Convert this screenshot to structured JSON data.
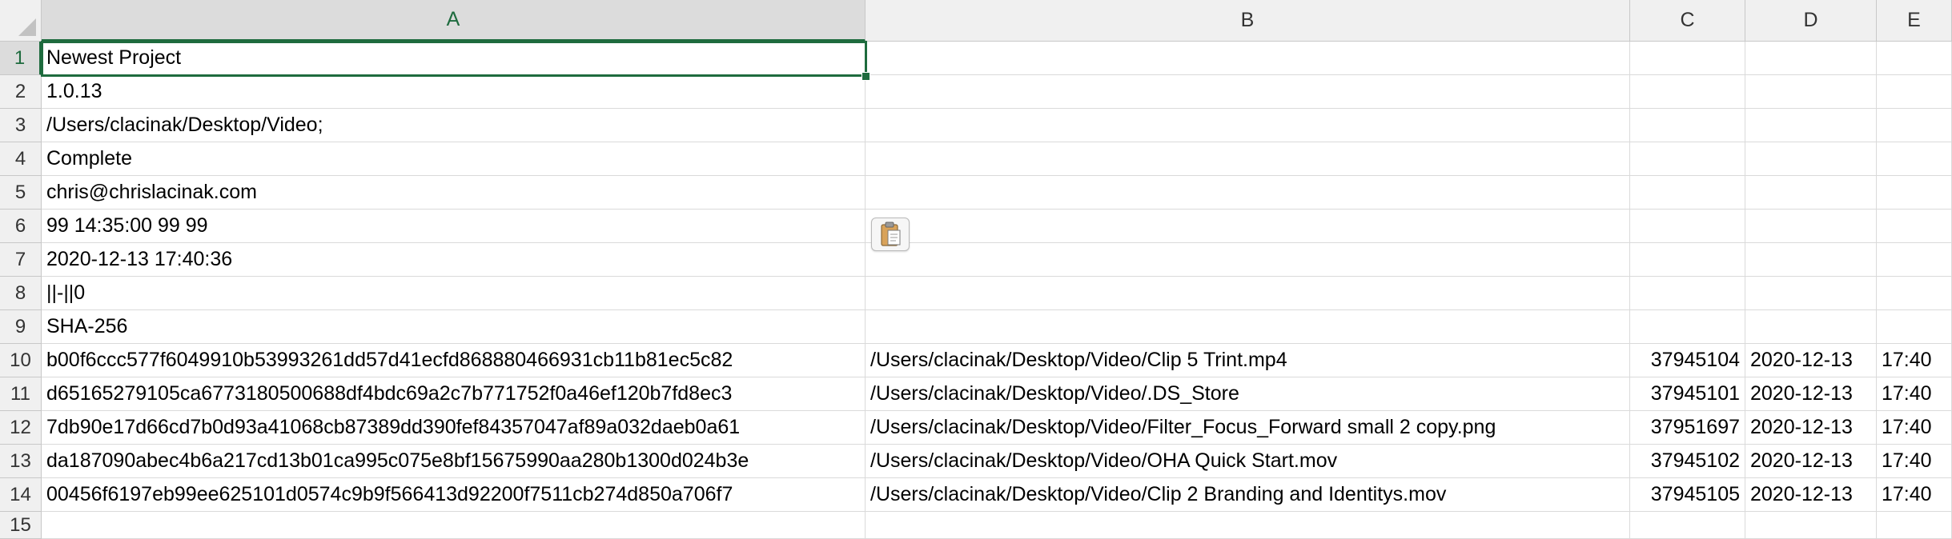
{
  "columns": [
    "A",
    "B",
    "C",
    "D",
    "E"
  ],
  "active_cell": "A1",
  "rows": [
    {
      "n": "1",
      "a": "Newest Project",
      "b": "",
      "c": "",
      "d": "",
      "e": ""
    },
    {
      "n": "2",
      "a": "1.0.13",
      "b": "",
      "c": "",
      "d": "",
      "e": ""
    },
    {
      "n": "3",
      "a": "/Users/clacinak/Desktop/Video;",
      "b": "",
      "c": "",
      "d": "",
      "e": ""
    },
    {
      "n": "4",
      "a": "Complete",
      "b": "",
      "c": "",
      "d": "",
      "e": ""
    },
    {
      "n": "5",
      "a": "chris@chrislacinak.com",
      "b": "",
      "c": "",
      "d": "",
      "e": ""
    },
    {
      "n": "6",
      "a": "99 14:35:00 99 99",
      "b": "",
      "c": "",
      "d": "",
      "e": ""
    },
    {
      "n": "7",
      "a": "2020-12-13 17:40:36",
      "b": "",
      "c": "",
      "d": "",
      "e": ""
    },
    {
      "n": "8",
      "a": "||-||0",
      "b": "",
      "c": "",
      "d": "",
      "e": ""
    },
    {
      "n": "9",
      "a": "SHA-256",
      "b": "",
      "c": "",
      "d": "",
      "e": ""
    },
    {
      "n": "10",
      "a": "b00f6ccc577f6049910b53993261dd57d41ecfd868880466931cb11b81ec5c82",
      "b": "/Users/clacinak/Desktop/Video/Clip 5 Trint.mp4",
      "c": "37945104",
      "d": "2020-12-13",
      "e": "17:40"
    },
    {
      "n": "11",
      "a": "d65165279105ca6773180500688df4bdc69a2c7b771752f0a46ef120b7fd8ec3",
      "b": "/Users/clacinak/Desktop/Video/.DS_Store",
      "c": "37945101",
      "d": "2020-12-13",
      "e": "17:40"
    },
    {
      "n": "12",
      "a": "7db90e17d66cd7b0d93a41068cb87389dd390fef84357047af89a032daeb0a61",
      "b": "/Users/clacinak/Desktop/Video/Filter_Focus_Forward small 2 copy.png",
      "c": "37951697",
      "d": "2020-12-13",
      "e": "17:40"
    },
    {
      "n": "13",
      "a": "da187090abec4b6a217cd13b01ca995c075e8bf15675990aa280b1300d024b3e",
      "b": "/Users/clacinak/Desktop/Video/OHA Quick Start.mov",
      "c": "37945102",
      "d": "2020-12-13",
      "e": "17:40"
    },
    {
      "n": "14",
      "a": "00456f6197eb99ee625101d0574c9b9f566413d92200f7511cb274d850a706f7",
      "b": "/Users/clacinak/Desktop/Video/Clip 2 Branding and Identitys.mov",
      "c": "37945105",
      "d": "2020-12-13",
      "e": "17:40"
    },
    {
      "n": "15",
      "a": "",
      "b": "",
      "c": "",
      "d": "",
      "e": ""
    }
  ],
  "colors": {
    "accent": "#1e6b3e",
    "header_bg": "#f0f0f0",
    "gridline": "#dadada"
  },
  "icons": {
    "paste_options": "clipboard-icon"
  }
}
